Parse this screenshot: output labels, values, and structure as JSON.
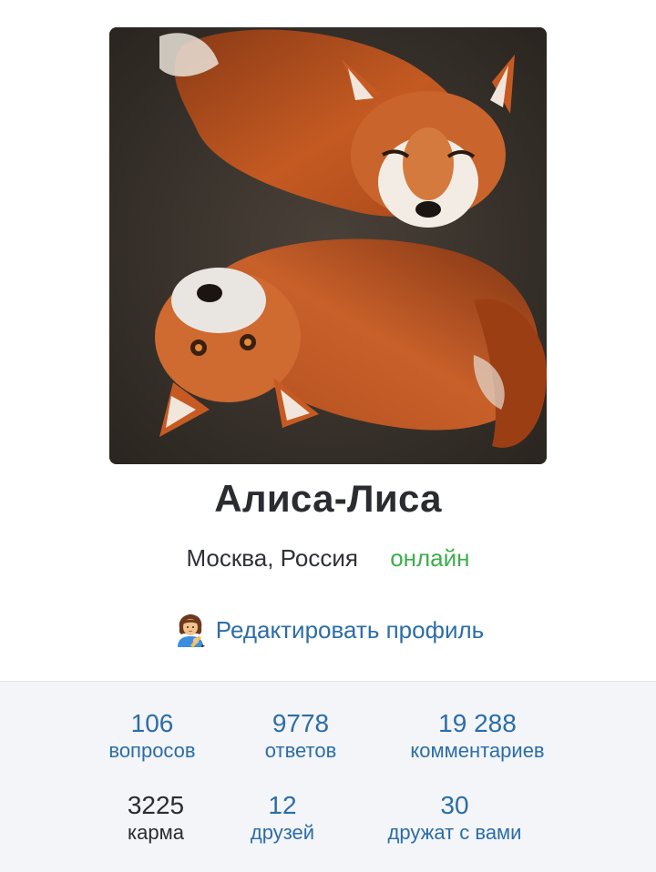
{
  "profile": {
    "avatar_alt": "Две лисы",
    "name": "Алиса-Лиса",
    "location": "Москва, Россия",
    "status": "онлайн",
    "edit_label": "Редактировать профиль"
  },
  "stats": {
    "questions": {
      "value": "106",
      "label": "вопросов"
    },
    "answers": {
      "value": "9778",
      "label": "ответов"
    },
    "comments": {
      "value": "19 288",
      "label": "комментариев"
    },
    "karma": {
      "value": "3225",
      "label": "карма"
    },
    "friends": {
      "value": "12",
      "label": "друзей"
    },
    "friends_of": {
      "value": "30",
      "label": "дружат с вами"
    }
  },
  "colors": {
    "link": "#2c6da7",
    "online": "#3cae4a",
    "text": "#2a2c30",
    "stats_bg": "#f3f5f8"
  },
  "icons": {
    "edit": "woman-writing-icon"
  }
}
